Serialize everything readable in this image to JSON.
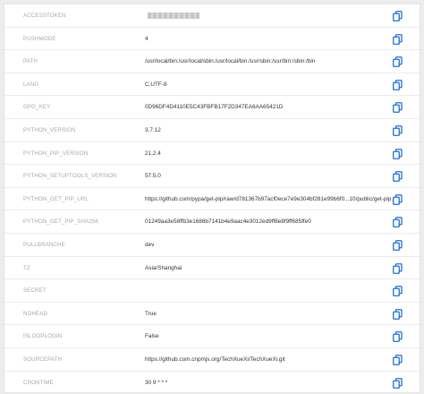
{
  "accent_color": "#1b6fd8",
  "rows": [
    {
      "key": "ACCESSTOKEN",
      "value": "",
      "masked": true
    },
    {
      "key": "PUSHMODE",
      "value": "4"
    },
    {
      "key": "PATH",
      "value": "/usr/local/bin:/usr/local/sbin:/usr/local/bin:/usr/sbin:/usr/bin:/sbin:/bin"
    },
    {
      "key": "LANG",
      "value": "C.UTF-8"
    },
    {
      "key": "GPG_KEY",
      "value": "0D96DF4D4110E5C43FBFB17F2D347EA6AA65421D"
    },
    {
      "key": "PYTHON_VERSION",
      "value": "3.7.12"
    },
    {
      "key": "PYTHON_PIP_VERSION",
      "value": "21.2.4"
    },
    {
      "key": "PYTHON_SETUPTOOLS_VERSION",
      "value": "57.5.0"
    },
    {
      "key": "PYTHON_GET_PIP_URL",
      "value": "https://github.com/pypa/get-pip/raw/d781367b97acf0ece7e9e304bf281e99b6f0...10/public/get-pip.py"
    },
    {
      "key": "PYTHON_GET_PIP_SHA256",
      "value": "01249aa3e58ffb3e1686b7141b4e9aac4e3012ed9ff8e8f9ff685ffe0"
    },
    {
      "key": "PULLBRANCHE",
      "value": "dev"
    },
    {
      "key": "TZ",
      "value": "Asia/Shanghai"
    },
    {
      "key": "SECRET",
      "value": ""
    },
    {
      "key": "NOHEAD",
      "value": "True"
    },
    {
      "key": "ISLOOPLOGIN",
      "value": "False"
    },
    {
      "key": "SOURCEPATH",
      "value": "https://github.com.cnpmjs.org/TechXueXi/TechXueXi.git"
    },
    {
      "key": "CRONTIME",
      "value": "30 9 * * *"
    }
  ],
  "copy_icon": "copy-icon"
}
